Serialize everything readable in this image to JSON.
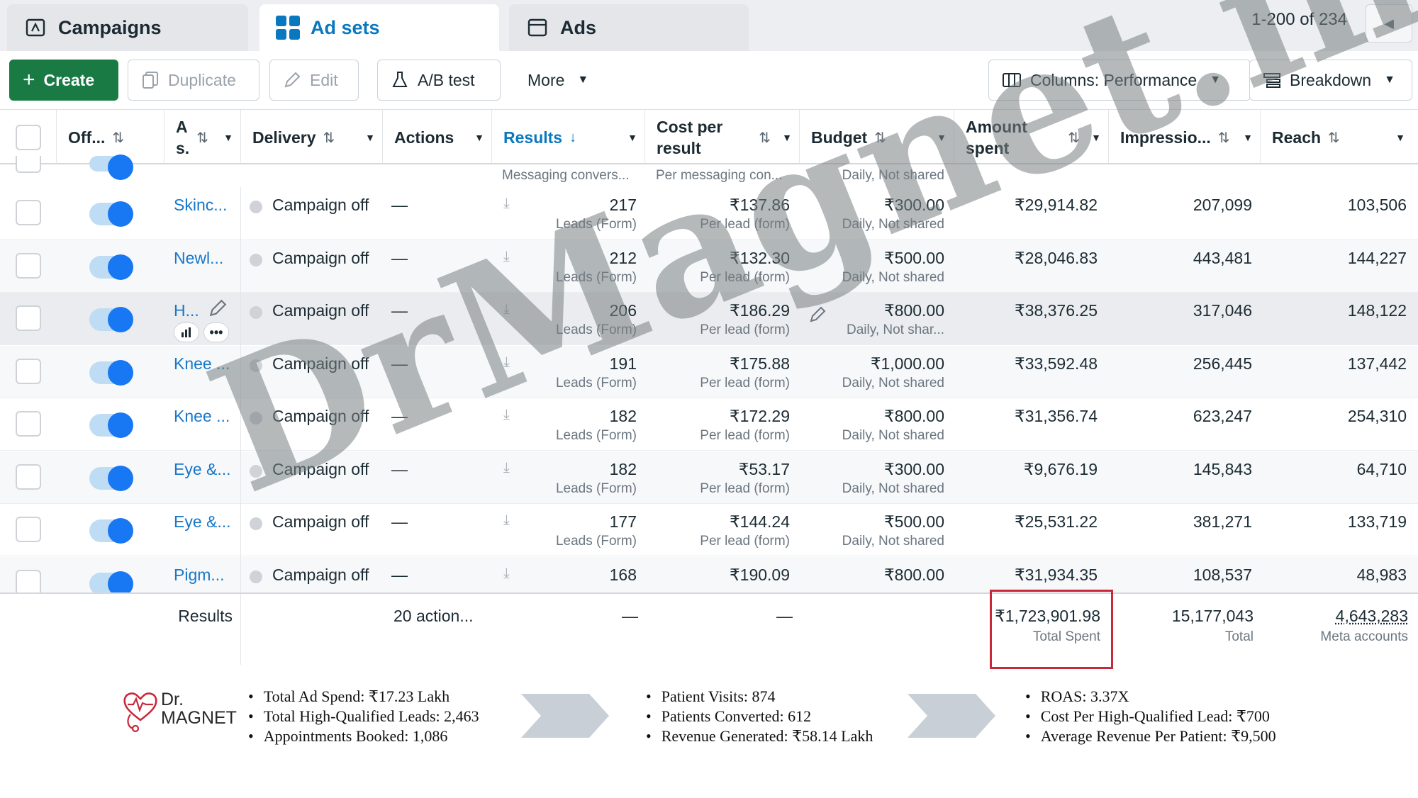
{
  "tabs": [
    {
      "label": "Campaigns",
      "icon": "campaign-icon"
    },
    {
      "label": "Ad sets",
      "icon": "grid-icon"
    },
    {
      "label": "Ads",
      "icon": "ad-icon"
    }
  ],
  "pager": {
    "text": "1-200 of 234"
  },
  "toolbar": {
    "create": "Create",
    "duplicate": "Duplicate",
    "edit": "Edit",
    "abtest": "A/B test",
    "more": "More",
    "columns": "Columns: Performance",
    "breakdown": "Breakdown"
  },
  "headers": {
    "off": "Off...",
    "as_line1": "A",
    "as_line2": "s.",
    "delivery": "Delivery",
    "actions": "Actions",
    "results": "Results",
    "cost_line1": "Cost per",
    "cost_line2": "result",
    "budget": "Budget",
    "amount_line1": "Amount",
    "amount_line2": "spent",
    "impressions": "Impressio...",
    "reach": "Reach"
  },
  "subheader": {
    "results": "Messaging convers...",
    "cost": "Per messaging con...",
    "budget": "Daily, Not shared"
  },
  "rows": [
    {
      "name": "Skinc...",
      "delivery": "Campaign off",
      "actions": "—",
      "results": "217",
      "results_sub": "Leads (Form)",
      "cost": "₹137.86",
      "cost_sub": "Per lead (form)",
      "budget": "₹300.00",
      "budget_sub": "Daily, Not shared",
      "amount": "₹29,914.82",
      "impressions": "207,099",
      "reach": "103,506"
    },
    {
      "name": "Newl...",
      "delivery": "Campaign off",
      "actions": "—",
      "results": "212",
      "results_sub": "Leads (Form)",
      "cost": "₹132.30",
      "cost_sub": "Per lead (form)",
      "budget": "₹500.00",
      "budget_sub": "Daily, Not shared",
      "amount": "₹28,046.83",
      "impressions": "443,481",
      "reach": "144,227"
    },
    {
      "name": "H...",
      "delivery": "Campaign off",
      "actions": "—",
      "results": "206",
      "results_sub": "Leads (Form)",
      "cost": "₹186.29",
      "cost_sub": "Per lead (form)",
      "budget": "₹800.00",
      "budget_sub": "Daily, Not shar...",
      "amount": "₹38,376.25",
      "impressions": "317,046",
      "reach": "148,122"
    },
    {
      "name": "Knee ...",
      "delivery": "Campaign off",
      "actions": "—",
      "results": "191",
      "results_sub": "Leads (Form)",
      "cost": "₹175.88",
      "cost_sub": "Per lead (form)",
      "budget": "₹1,000.00",
      "budget_sub": "Daily, Not shared",
      "amount": "₹33,592.48",
      "impressions": "256,445",
      "reach": "137,442"
    },
    {
      "name": "Knee ...",
      "delivery": "Campaign off",
      "actions": "—",
      "results": "182",
      "results_sub": "Leads (Form)",
      "cost": "₹172.29",
      "cost_sub": "Per lead (form)",
      "budget": "₹800.00",
      "budget_sub": "Daily, Not shared",
      "amount": "₹31,356.74",
      "impressions": "623,247",
      "reach": "254,310"
    },
    {
      "name": "Eye &...",
      "delivery": "Campaign off",
      "actions": "—",
      "results": "182",
      "results_sub": "Leads (Form)",
      "cost": "₹53.17",
      "cost_sub": "Per lead (form)",
      "budget": "₹300.00",
      "budget_sub": "Daily, Not shared",
      "amount": "₹9,676.19",
      "impressions": "145,843",
      "reach": "64,710"
    },
    {
      "name": "Eye &...",
      "delivery": "Campaign off",
      "actions": "—",
      "results": "177",
      "results_sub": "Leads (Form)",
      "cost": "₹144.24",
      "cost_sub": "Per lead (form)",
      "budget": "₹500.00",
      "budget_sub": "Daily, Not shared",
      "amount": "₹25,531.22",
      "impressions": "381,271",
      "reach": "133,719"
    },
    {
      "name": "Pigm...",
      "delivery": "Campaign off",
      "actions": "—",
      "results": "168",
      "results_sub": "",
      "cost": "₹190.09",
      "cost_sub": "",
      "budget": "₹800.00",
      "budget_sub": "",
      "amount": "₹31,934.35",
      "impressions": "108,537",
      "reach": "48,983"
    }
  ],
  "totals": {
    "label": "Results",
    "actions": "20 action...",
    "results": "—",
    "cost": "—",
    "amount": "₹1,723,901.98",
    "amount_sub": "Total Spent",
    "impressions": "15,177,043",
    "impressions_sub": "Total",
    "reach": "4,643,283",
    "reach_sub": "Meta accounts"
  },
  "watermark": "DrMagnet.in",
  "logo": {
    "line1": "Dr.",
    "line2": "MAGNET"
  },
  "summary": {
    "col1": [
      "Total Ad Spend: ₹17.23 Lakh",
      "Total High-Qualified Leads: 2,463",
      "Appointments Booked: 1,086"
    ],
    "col2": [
      "Patient Visits: 874",
      "Patients Converted: 612",
      "Revenue Generated: ₹58.14 Lakh"
    ],
    "col3": [
      "ROAS: 3.37X",
      "Cost Per High-Qualified Lead: ₹700",
      "Average Revenue Per Patient: ₹9,500"
    ]
  },
  "colors": {
    "accent": "#1877f2",
    "create": "#1a7a44",
    "highlight_box": "#c8283a",
    "arrow": "#c8cfd6"
  }
}
